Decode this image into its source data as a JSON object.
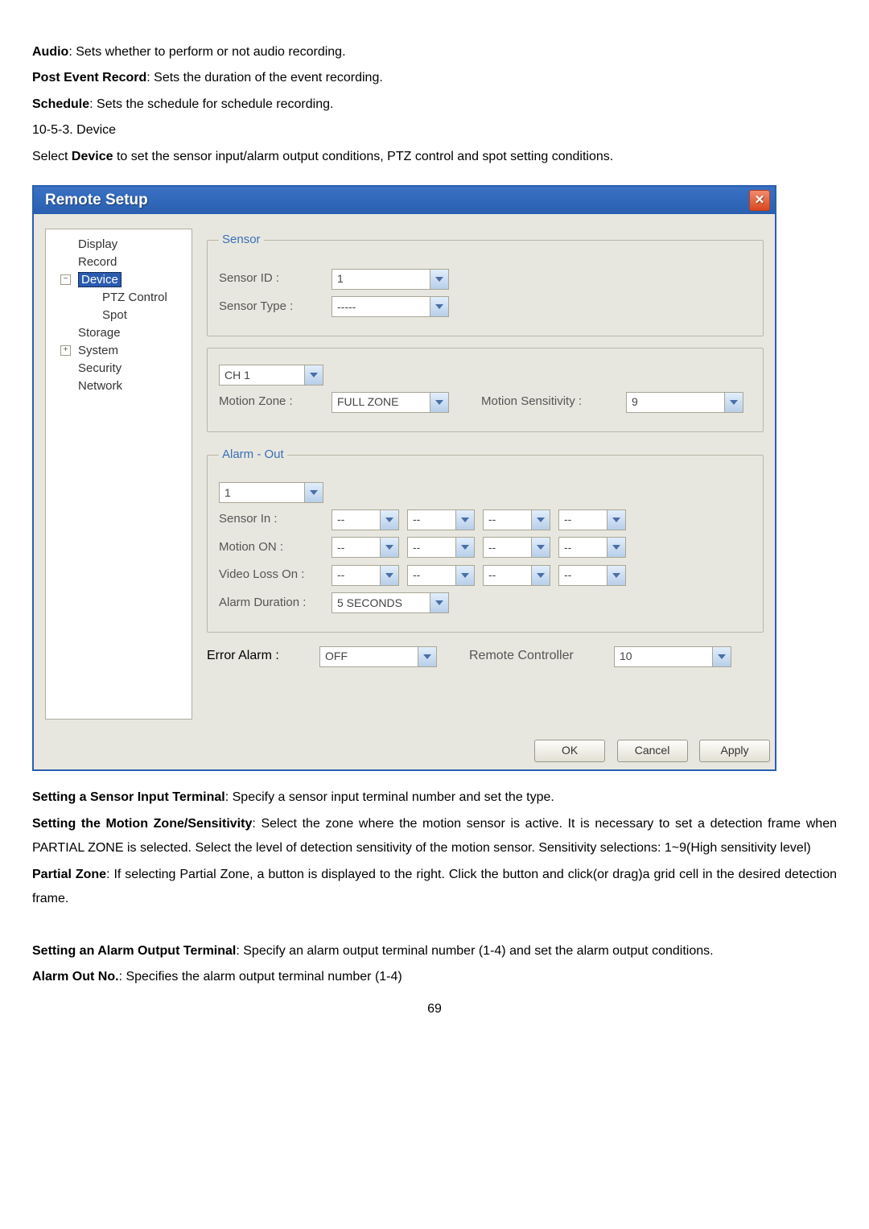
{
  "intro": {
    "audio_label": "Audio",
    "audio_text": ": Sets whether to perform or not audio recording.",
    "per_label": "Post Event Record",
    "per_text": ": Sets the duration of the event recording.",
    "sched_label": "Schedule",
    "sched_text": ": Sets the schedule for schedule recording.",
    "section_num": " 10-5-3. Device",
    "select_line_a": "Select ",
    "select_bold": "Device",
    "select_line_b": " to set the sensor input/alarm output conditions, PTZ control and spot setting conditions."
  },
  "window": {
    "title": "Remote Setup",
    "close_glyph": "✕",
    "tree": [
      {
        "label": "Display",
        "level": 0
      },
      {
        "label": "Record",
        "level": 0
      },
      {
        "label": "Device",
        "level": 0,
        "expander": "−",
        "selected": true
      },
      {
        "label": "PTZ Control",
        "level": 1
      },
      {
        "label": "Spot",
        "level": 1
      },
      {
        "label": "Storage",
        "level": 0
      },
      {
        "label": "System",
        "level": 0,
        "expander": "+"
      },
      {
        "label": "Security",
        "level": 0
      },
      {
        "label": "Network",
        "level": 0
      }
    ],
    "sensor": {
      "legend": "Sensor",
      "id_label": "Sensor ID :",
      "id_value": "1",
      "type_label": "Sensor Type :",
      "type_value": "-----"
    },
    "motion": {
      "channel_value": "CH 1",
      "zone_label": "Motion Zone :",
      "zone_value": "FULL ZONE",
      "sens_label": "Motion Sensitivity :",
      "sens_value": "9"
    },
    "alarm": {
      "legend": "Alarm - Out",
      "number_value": "1",
      "sensor_in_label": "Sensor In :",
      "motion_on_label": "Motion ON :",
      "video_loss_label": "Video Loss On :",
      "duration_label": "Alarm Duration :",
      "duration_value": "5 SECONDS",
      "dash": "--"
    },
    "error": {
      "label": "Error Alarm :",
      "value": "OFF",
      "remote_label": "Remote Controller",
      "remote_value": "10"
    },
    "buttons": {
      "ok": "OK",
      "cancel": "Cancel",
      "apply": "Apply"
    }
  },
  "after": {
    "s1a": "Setting a Sensor Input Terminal",
    "s1b": ": Specify a sensor input terminal number and set the type.",
    "s2a": "Setting the Motion Zone/Sensitivity",
    "s2b": ": Select the zone where the motion sensor is active. It is necessary to set a detection frame when PARTIAL ZONE is selected. Select the level of detection sensitivity of the motion sensor. Sensitivity selections: 1~9(High sensitivity level)",
    "s3a": "Partial Zone",
    "s3b": ": If selecting Partial Zone, a button is displayed to the right. Click the button and click(or drag)a grid cell in the desired detection frame.",
    "s4a": "Setting an Alarm Output Terminal",
    "s4b": ": Specify an alarm output terminal number (1-4) and set the alarm output conditions.",
    "s5a": "Alarm Out No.",
    "s5b": ": Specifies the alarm output terminal number (1-4)"
  },
  "page_number": "69"
}
